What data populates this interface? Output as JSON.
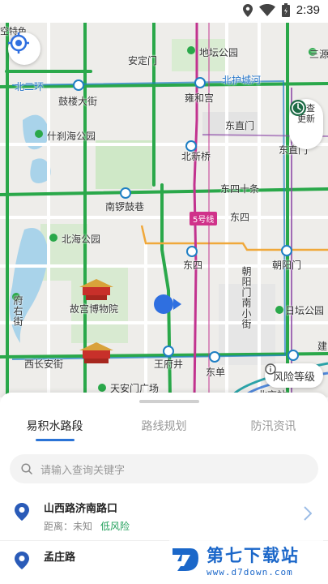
{
  "status_bar": {
    "time": "2:39",
    "icons": [
      "location-icon",
      "wifi-icon",
      "battery-icon"
    ]
  },
  "map": {
    "labels": {
      "top_left_fragment": "空特色",
      "andingmen": "安定门",
      "ditan_park": "地坛公园",
      "er_huan_north": "北二环",
      "beihucheng_he": "北护城河",
      "yonghegong": "雍和宫",
      "gulou_dajie": "鼓楼大街",
      "shichahai_park": "什刹海公园",
      "dongzhimen": "东直门",
      "dongzhimen_east": "东直门",
      "beixinqiao": "北新桥",
      "dongsi_shitiao": "东四十条",
      "nanluoguxiang": "南锣鼓巷",
      "dongsi_area": "东四",
      "line5": "5号线",
      "beihai_park": "北海公园",
      "dongsi_station": "东四",
      "chaoyangmen": "朝阳门",
      "chaoyangmen_nanxiaojie": "朝阳门南小街",
      "ritan_park": "日坛公园",
      "fuyou_street": "府右街",
      "palace_museum": "故宫博物院",
      "xichang_anjie": "西长安街",
      "wangfujing": "王府井",
      "dongdan": "东单",
      "tiananmen_square": "天安门广场",
      "beijing_station": "北京站",
      "jian_fragment": "建",
      "top_right_fragment": "三源"
    },
    "buttons": {
      "update_label": "检查更新",
      "risk_label": "风险等级"
    },
    "colors": {
      "route_green": "#2aa84a",
      "line5_magenta": "#c2338f",
      "line2_blue": "#1f7fc4",
      "park_green": "#cfe8c7",
      "water": "#a9d3ea",
      "location_dot": "#2f6fe0"
    }
  },
  "sheet": {
    "tabs": [
      {
        "label": "易积水路段",
        "active": true
      },
      {
        "label": "路线规划",
        "active": false
      },
      {
        "label": "防汛资讯",
        "active": false
      }
    ],
    "search": {
      "placeholder": "请输入查询关键字"
    },
    "items": [
      {
        "title": "山西路济南路口",
        "distance_label": "距离：未知",
        "risk": "低风险"
      },
      {
        "title": "孟庄路",
        "distance_label": "",
        "risk": ""
      }
    ]
  },
  "watermark": {
    "name": "第七下载站",
    "url": "www.d7down.com"
  }
}
